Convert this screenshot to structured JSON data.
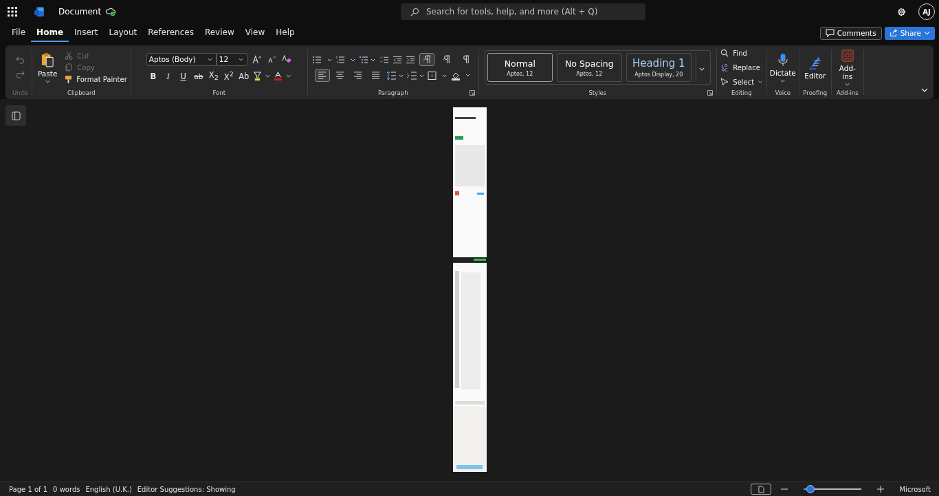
{
  "app_bar": {
    "title": "Document",
    "search": {
      "placeholder": "Search for tools, help, and more (Alt + Q)"
    },
    "avatar": "AJ"
  },
  "menu_tabs": [
    {
      "label": "File",
      "selected": false
    },
    {
      "label": "Home",
      "selected": true
    },
    {
      "label": "Insert",
      "selected": false
    },
    {
      "label": "Layout",
      "selected": false
    },
    {
      "label": "References",
      "selected": false
    },
    {
      "label": "Review",
      "selected": false
    },
    {
      "label": "View",
      "selected": false
    },
    {
      "label": "Help",
      "selected": false
    }
  ],
  "actions": {
    "comments": "Comments",
    "share": "Share"
  },
  "ribbon": {
    "undo": {
      "label": "Undo"
    },
    "clipboard": {
      "paste": "Paste",
      "items": [
        {
          "kind": "cut",
          "label": "Cut",
          "disabled": true
        },
        {
          "kind": "copy",
          "label": "Copy",
          "disabled": true
        },
        {
          "kind": "painter",
          "label": "Format Painter",
          "disabled": false
        }
      ],
      "label": "Clipboard"
    },
    "font": {
      "name": "Aptos (Body)",
      "size": "12",
      "format_buttons": [
        {
          "label": "B",
          "kind": "bold"
        },
        {
          "label": "I",
          "kind": "italic"
        },
        {
          "label": "U",
          "kind": "underline"
        },
        {
          "label": "ab",
          "kind": "strike"
        },
        {
          "label": "X$_{2}$",
          "kind": "plain"
        },
        {
          "label": "X$^{2}$",
          "kind": "plain"
        },
        {
          "label": "Ab",
          "kind": "plain"
        }
      ],
      "label": "Font"
    },
    "paragraph": {
      "toggles": [
        {
          "kind": "ltr",
          "selected": true
        },
        {
          "kind": "rtl",
          "selected": false
        },
        {
          "kind": "marks",
          "selected": false
        }
      ],
      "alignment": [
        {
          "kind": "left",
          "selected": true
        },
        {
          "kind": "center",
          "selected": false
        },
        {
          "kind": "right",
          "selected": false
        },
        {
          "kind": "justify",
          "selected": false
        }
      ],
      "label": "Paragraph"
    },
    "styles": {
      "items": [
        {
          "name": "Normal",
          "detail": "Aptos, 12",
          "kind": "body",
          "selected": true
        },
        {
          "name": "No Spacing",
          "detail": "Aptos, 12",
          "kind": "body",
          "selected": false
        },
        {
          "name": "Heading 1",
          "detail": "Aptos Display, 20",
          "kind": "heading",
          "selected": false
        }
      ],
      "label": "Styles"
    },
    "editing": {
      "items": [
        {
          "kind": "find",
          "label": "Find"
        },
        {
          "kind": "replace",
          "label": "Replace"
        },
        {
          "kind": "select",
          "label": "Select"
        }
      ],
      "label": "Editing"
    },
    "big_groups": [
      {
        "kind": "dictate",
        "button": "Dictate",
        "label": "Voice"
      },
      {
        "kind": "editor",
        "button": "Editor",
        "label": "Proofing"
      },
      {
        "kind": "addins",
        "button": "Add-ins",
        "label": "Add-ins"
      }
    ]
  },
  "status_bar": {
    "items": [
      "Page 1 of 1",
      "0 words",
      "English (U.K.)",
      "Editor Suggestions: Showing"
    ],
    "zoom": {
      "level": 0.1
    },
    "brand": "Microsoft"
  }
}
